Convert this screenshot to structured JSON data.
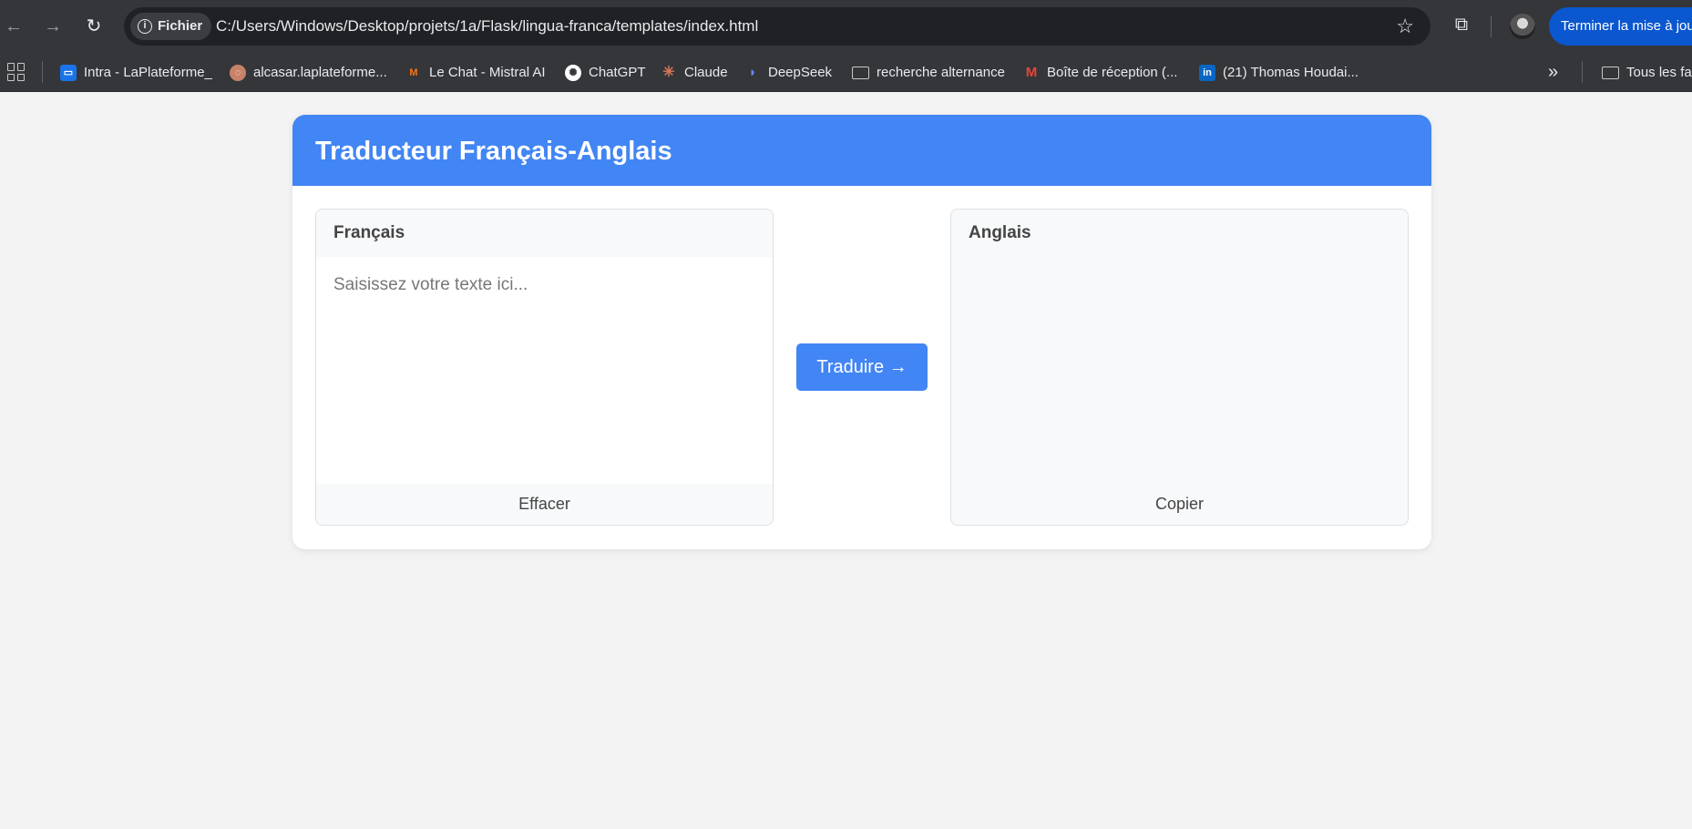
{
  "browser": {
    "site_chip": "Fichier",
    "url": "C:/Users/Windows/Desktop/projets/1a/Flask/lingua-franca/templates/index.html",
    "update_button": "Terminer la mise à jour",
    "bookmarks": [
      {
        "label": "Intra - LaPlateforme_",
        "icon": "laplateforme-icon",
        "color": "#1a73e8"
      },
      {
        "label": "alcasar.laplateforme...",
        "icon": "alcasar-icon",
        "color": "#c8826a"
      },
      {
        "label": "Le Chat - Mistral AI",
        "icon": "mistral-icon",
        "color": "#f97316"
      },
      {
        "label": "ChatGPT",
        "icon": "chatgpt-icon",
        "color": "#ffffff"
      },
      {
        "label": "Claude",
        "icon": "claude-icon",
        "color": "#d97757"
      },
      {
        "label": "DeepSeek",
        "icon": "deepseek-icon",
        "color": "#4d6bfe"
      },
      {
        "label": "recherche alternance",
        "icon": "folder-icon",
        "color": "#c7c7c7"
      },
      {
        "label": "Boîte de réception (...",
        "icon": "gmail-icon",
        "color": "#ea4335"
      },
      {
        "label": "(21) Thomas Houdai...",
        "icon": "linkedin-icon",
        "color": "#0a66c2"
      }
    ],
    "all_bookmarks": "Tous les favoris"
  },
  "app": {
    "title": "Traducteur Français-Anglais",
    "source": {
      "title": "Français",
      "placeholder": "Saisissez votre texte ici...",
      "value": "",
      "clear_label": "Effacer"
    },
    "translate_label": "Traduire →",
    "target": {
      "title": "Anglais",
      "value": "",
      "copy_label": "Copier"
    }
  },
  "colors": {
    "accent": "#4285f4",
    "page_bg": "#f3f3f3",
    "chrome_bg": "#35363a"
  }
}
